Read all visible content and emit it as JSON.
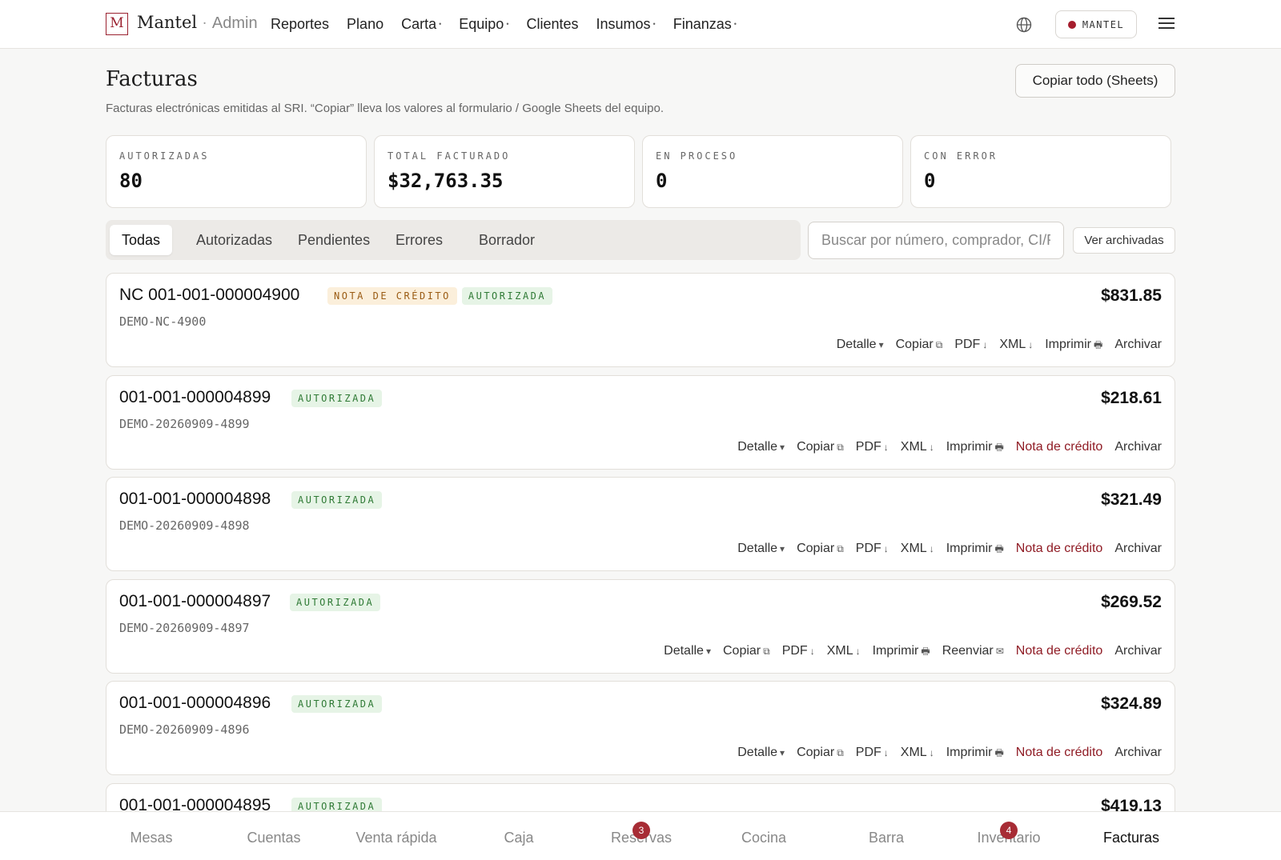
{
  "brand": {
    "logo_letter": "M",
    "name": "Mantel",
    "separator": "·",
    "suffix": "Admin"
  },
  "nav": [
    {
      "label": "Reportes",
      "dropdown": false
    },
    {
      "label": "Plano",
      "dropdown": false
    },
    {
      "label": "Carta",
      "dropdown": true
    },
    {
      "label": "Equipo",
      "dropdown": true
    },
    {
      "label": "Clientes",
      "dropdown": false
    },
    {
      "label": "Insumos",
      "dropdown": true
    },
    {
      "label": "Finanzas",
      "dropdown": true
    }
  ],
  "account": {
    "label": "MANTEL",
    "dot_color": "#a51d2d"
  },
  "header": {
    "title": "Facturas",
    "subtitle": "Facturas electrónicas emitidas al SRI. “Copiar” lleva los valores al formulario / Google Sheets del equipo.",
    "copy_all": "Copiar todo (Sheets)"
  },
  "stats": [
    {
      "label": "AUTORIZADAS",
      "value": "80"
    },
    {
      "label": "TOTAL FACTURADO",
      "value": "$32,763.35"
    },
    {
      "label": "EN PROCESO",
      "value": "0"
    },
    {
      "label": "CON ERROR",
      "value": "0"
    }
  ],
  "tabs": [
    {
      "label": "Todas",
      "active": true
    },
    {
      "label": "Autorizadas",
      "active": false
    },
    {
      "label": "Pendientes",
      "active": false
    },
    {
      "label": "Errores",
      "active": false
    },
    {
      "label": "Borrador",
      "active": false
    }
  ],
  "search": {
    "placeholder": "Buscar por número, comprador, CI/RUC"
  },
  "archived_button": "Ver archivadas",
  "invoices": [
    {
      "number": "NC 001-001-000004900",
      "badges": [
        "NOTA DE CRÉDITO",
        "AUTORIZADA"
      ],
      "ref": "DEMO-NC-4900",
      "amount": "$831.85",
      "actions": [
        "Detalle",
        "Copiar",
        "PDF",
        "XML",
        "Imprimir",
        "Archivar"
      ]
    },
    {
      "number": "001-001-000004899",
      "badges": [
        "AUTORIZADA"
      ],
      "ref": "DEMO-20260909-4899",
      "amount": "$218.61",
      "actions": [
        "Detalle",
        "Copiar",
        "PDF",
        "XML",
        "Imprimir",
        "Nota de crédito",
        "Archivar"
      ]
    },
    {
      "number": "001-001-000004898",
      "badges": [
        "AUTORIZADA"
      ],
      "ref": "DEMO-20260909-4898",
      "amount": "$321.49",
      "actions": [
        "Detalle",
        "Copiar",
        "PDF",
        "XML",
        "Imprimir",
        "Nota de crédito",
        "Archivar"
      ]
    },
    {
      "number": "001-001-000004897",
      "badges": [
        "AUTORIZADA"
      ],
      "ref": "DEMO-20260909-4897",
      "amount": "$269.52",
      "actions": [
        "Detalle",
        "Copiar",
        "PDF",
        "XML",
        "Imprimir",
        "Reenviar",
        "Nota de crédito",
        "Archivar"
      ]
    },
    {
      "number": "001-001-000004896",
      "badges": [
        "AUTORIZADA"
      ],
      "ref": "DEMO-20260909-4896",
      "amount": "$324.89",
      "actions": [
        "Detalle",
        "Copiar",
        "PDF",
        "XML",
        "Imprimir",
        "Nota de crédito",
        "Archivar"
      ]
    },
    {
      "number": "001-001-000004895",
      "badges": [
        "AUTORIZADA"
      ],
      "ref": "",
      "amount": "$419.13",
      "actions": []
    }
  ],
  "bottom_nav": [
    {
      "label": "Mesas",
      "badge": ""
    },
    {
      "label": "Cuentas",
      "badge": ""
    },
    {
      "label": "Venta rápida",
      "badge": ""
    },
    {
      "label": "Caja",
      "badge": ""
    },
    {
      "label": "Reservas",
      "badge": "3"
    },
    {
      "label": "Cocina",
      "badge": ""
    },
    {
      "label": "Barra",
      "badge": ""
    },
    {
      "label": "Inventario",
      "badge": "4"
    },
    {
      "label": "Facturas",
      "badge": "",
      "active": true
    }
  ],
  "action_icons": {
    "Detalle": "▾",
    "Copiar": "⧉",
    "PDF": "↓",
    "XML": "↓",
    "Imprimir": "🖶",
    "Reenviar": "✉"
  },
  "colors": {
    "accent": "#9b2230",
    "ok_badge_bg": "#e6f4e6",
    "nc_badge_bg": "#fbefdb",
    "badge_red": "#a72c35"
  }
}
